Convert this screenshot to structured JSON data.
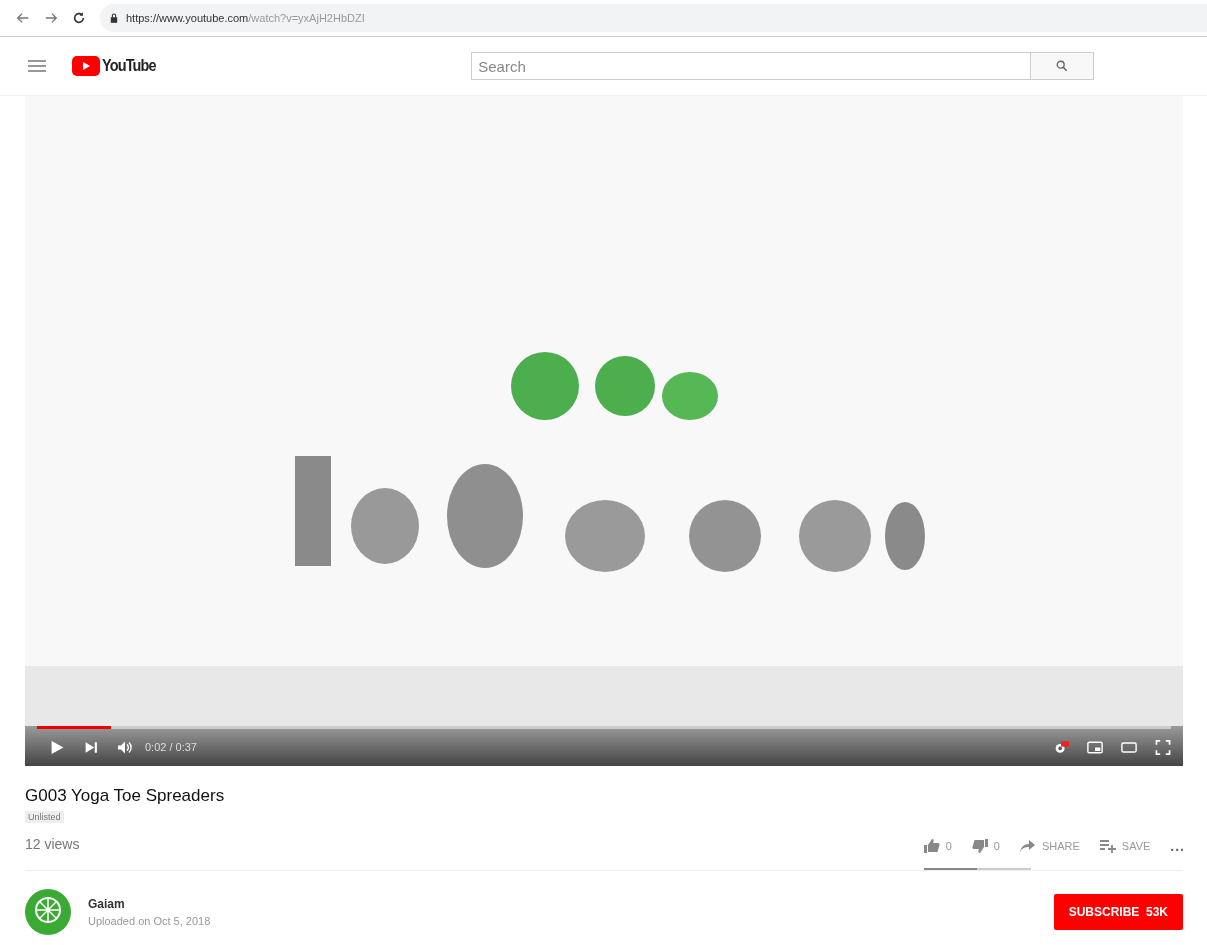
{
  "browser": {
    "url_host": "https://www.youtube.com",
    "url_path": "/watch?v=yxAjH2HbDZI"
  },
  "header": {
    "logo": "YouTube",
    "search": {
      "placeholder": "Search"
    }
  },
  "player": {
    "progress": {
      "level": 0.065
    },
    "time": "0:02 / 0:37"
  },
  "video": {
    "title": "G003 Yoga Toe Spreaders",
    "badge": "Unlisted",
    "views": "12 views",
    "actions": [
      {
        "kind": "like",
        "label": "0"
      },
      {
        "kind": "dislike",
        "label": "0"
      },
      {
        "kind": "share",
        "label": "SHARE"
      },
      {
        "kind": "save",
        "label": "SAVE"
      },
      {
        "kind": "more",
        "label": "..."
      }
    ],
    "sentiment_bar": {
      "level": 0.5
    }
  },
  "channel": {
    "name": "Gaiam",
    "uploaded": "Uploaded on Oct 5, 2018",
    "subscribe": "SUBSCRIBE",
    "subscribers": "53K"
  }
}
